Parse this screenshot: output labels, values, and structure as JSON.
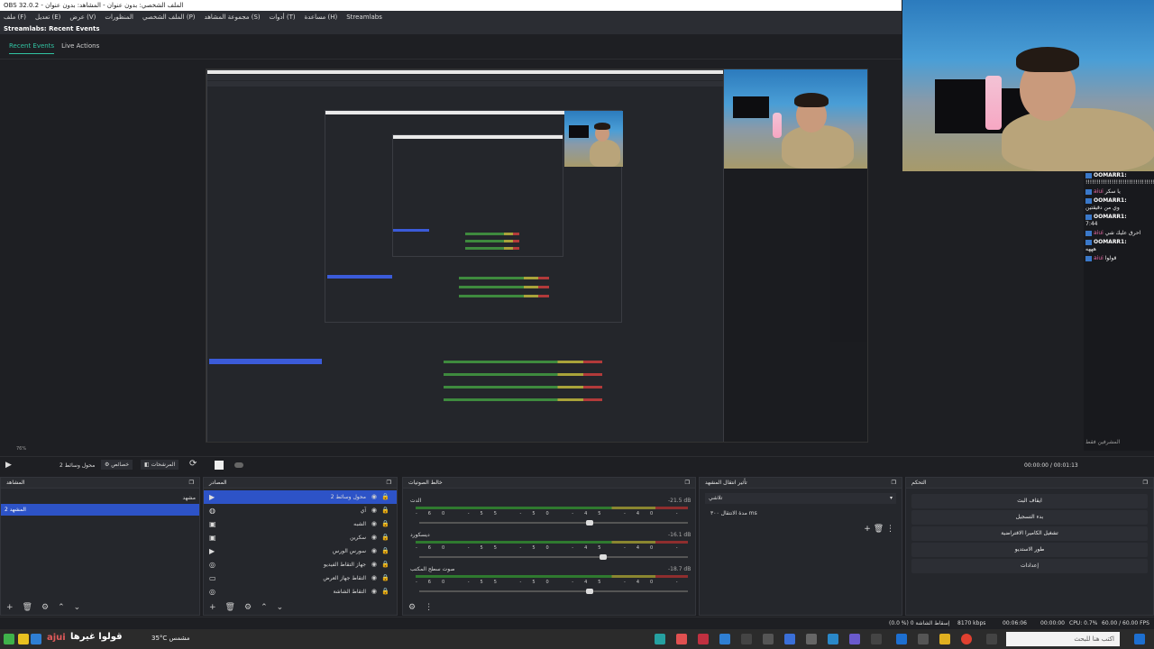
{
  "window": {
    "title": "OBS 32.0.2 - الملف الشخصي: بدون عنوان - المشاهد: بدون عنوان"
  },
  "menu": {
    "items": [
      "ملف (F)",
      "تعديل (E)",
      "عرض (V)",
      "المنظورات",
      "الملف الشخصي (P)",
      "مجموعة المشاهد (S)",
      "أدوات (T)",
      "مساعدة (H)",
      "Streamlabs"
    ]
  },
  "dock": {
    "title": "Streamlabs: Recent Events",
    "tabs": [
      "Recent Events",
      "Live Actions"
    ]
  },
  "chat": {
    "messages": [
      {
        "user": "OOMARR1:",
        "text": "!!!!!!!!!!!!!!!!!!!!!!!!!!!!!!!!!!!!!!!!!!!!!!!!!!!"
      },
      {
        "user": "aiui",
        "text": "يا سكر"
      },
      {
        "user": "OOMARR1:",
        "text": "وي من دقيقتين"
      },
      {
        "user": "OOMARR1:",
        "text": "7:44"
      },
      {
        "user": "aiui",
        "text": "احرق عليك شي"
      },
      {
        "user": "OOMARR1:",
        "text": "هههه"
      },
      {
        "user": "aiui",
        "text": "قولوا"
      }
    ],
    "footer": "المشرفين فقط"
  },
  "controls": {
    "zoom": "76%",
    "scene_label": "محول وسائط 2",
    "properties": "خصائص",
    "filters": "المرشحات",
    "time": "00:00:00 / 00:01:13"
  },
  "scenes": {
    "title": "المشاهد",
    "items": [
      "مشهد",
      "المشهد 2"
    ],
    "selected": 1
  },
  "sources": {
    "title": "المصادر",
    "items": [
      {
        "icon": "play-icon",
        "label": "محول وسائط 2"
      },
      {
        "icon": "audio-icon",
        "label": "آي"
      },
      {
        "icon": "image-icon",
        "label": "الشبه"
      },
      {
        "icon": "image-icon",
        "label": "سكرين"
      },
      {
        "icon": "play-icon",
        "label": "سورس الورس"
      },
      {
        "icon": "camera-icon",
        "label": "جهاز التقاط الفيديو"
      },
      {
        "icon": "monitor-icon",
        "label": "التقاط جهاز العرض"
      },
      {
        "icon": "camera-icon",
        "label": "التقاط الشاشة"
      }
    ]
  },
  "mixer": {
    "title": "خالط الصوتيات",
    "channels": [
      {
        "name": "الدت",
        "db": "-21.5 dB",
        "level": 0.62
      },
      {
        "name": "ديسكورد",
        "db": "-16.1 dB",
        "level": 0.67
      },
      {
        "name": "صوت سطح المكتب",
        "db": "-18.7 dB",
        "level": 0.62
      }
    ],
    "scale": "-60 -55 -50 -45 -40 -35 -30 -25 -20 -15 -10 -5 0"
  },
  "transitions": {
    "title": "تأثير انتقال المشهد",
    "type": "تلاشي",
    "duration_label": "مدة الانتقال",
    "duration_value": "٣٠٠ ms"
  },
  "controls_dock": {
    "title": "التحكم",
    "buttons": [
      "ايقاف البث",
      "بدء التسجيل",
      "تشغيل الكاميرا الافتراضية",
      "طور الاستديو",
      "إعدادات"
    ]
  },
  "status": {
    "dropped": "(0.0 %) 0 إسقاط الشاشة",
    "kbps": "8170 kbps",
    "live_time": "00:06:06",
    "rec_time": "00:00:00",
    "cpu": "CPU: 0.7%",
    "fps": "60.00 / 60.00 FPS"
  },
  "taskbar": {
    "overlay_text": "قولوا غيرها",
    "weather": "35°C مشمس",
    "search": "اكتب هنا للبحث"
  }
}
